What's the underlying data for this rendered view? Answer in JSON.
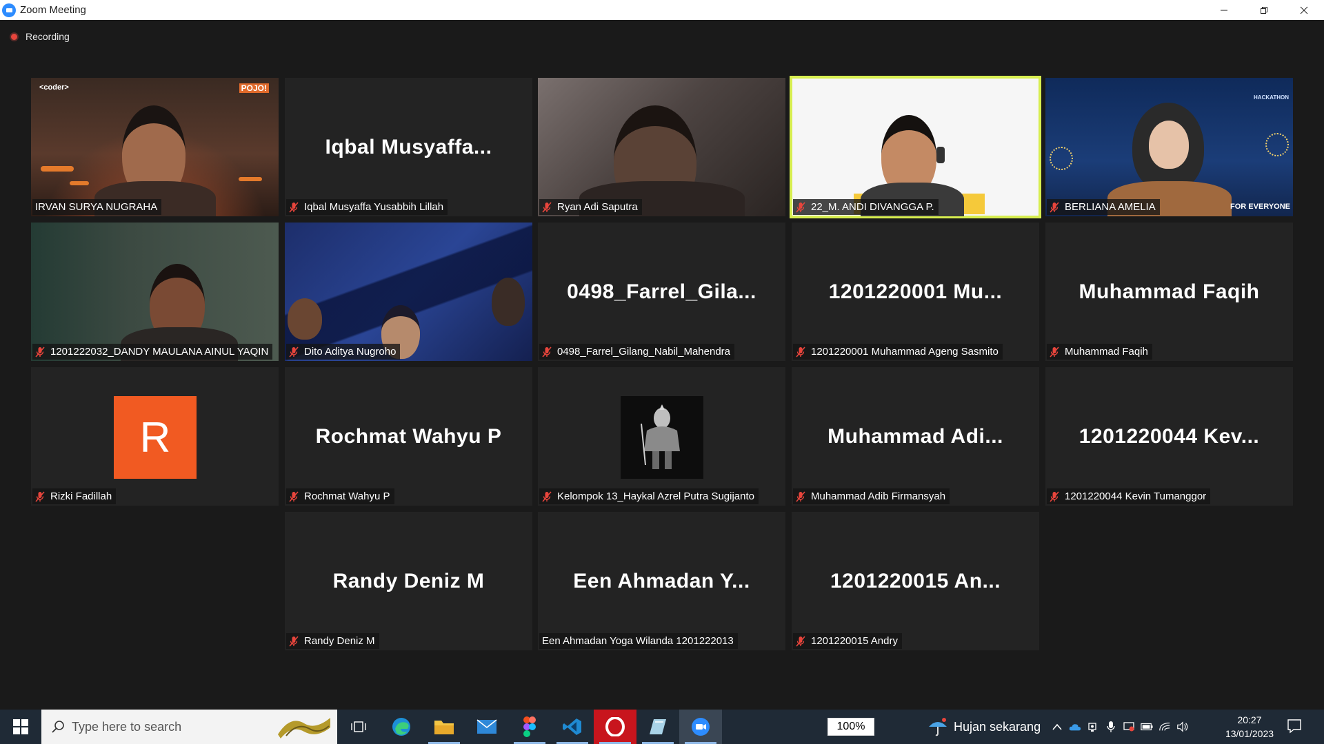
{
  "window": {
    "title": "Zoom Meeting"
  },
  "meeting": {
    "recording_label": "Recording"
  },
  "tiles": [
    {
      "label": "IRVAN SURYA NUGRAHA",
      "big": "",
      "muted": false
    },
    {
      "label": "Iqbal Musyaffa Yusabbih Lillah",
      "big": "Iqbal  Musyaffa...",
      "muted": true
    },
    {
      "label": "Ryan Adi Saputra",
      "big": "",
      "muted": true
    },
    {
      "label": "22_M. ANDI DIVANGGA P.",
      "big": "",
      "muted": true
    },
    {
      "label": "BERLIANA AMELIA",
      "big": "",
      "muted": true
    },
    {
      "label": "1201222032_DANDY MAULANA AINUL YAQIN",
      "big": "",
      "muted": true
    },
    {
      "label": "Dito Aditya Nugroho",
      "big": "",
      "muted": true
    },
    {
      "label": "0498_Farrel_Gilang_Nabil_Mahendra",
      "big": "0498_Farrel_Gila...",
      "muted": true
    },
    {
      "label": "1201220001 Muhammad Ageng Sasmito",
      "big": "1201220001  Mu...",
      "muted": true
    },
    {
      "label": "Muhammad Faqih",
      "big": "Muhammad Faqih",
      "muted": true
    },
    {
      "label": "Rizki Fadillah",
      "big": "",
      "avatar": "R",
      "muted": true
    },
    {
      "label": "Rochmat Wahyu P",
      "big": "Rochmat Wahyu P",
      "muted": true
    },
    {
      "label": "Kelompok 13_Haykal Azrel Putra Sugijanto",
      "big": "",
      "muted": true
    },
    {
      "label": "Muhammad Adib Firmansyah",
      "big": "Muhammad  Adi...",
      "muted": true
    },
    {
      "label": "1201220044 Kevin Tumanggor",
      "big": "1201220044  Kev...",
      "muted": true
    },
    {
      "label": "Randy Deniz M",
      "big": "Randy Deniz M",
      "muted": true
    },
    {
      "label": "Een Ahmadan Yoga Wilanda 1201222013",
      "big": "Een Ahmadan Y...",
      "muted": false
    },
    {
      "label": "1201220015 Andry",
      "big": "1201220015  An...",
      "muted": true
    }
  ],
  "video_overlays": {
    "irvan_left_logo": "<coder>",
    "irvan_right_logo": "POJO!",
    "berliana_banner": "FOR EVERYONE",
    "berliana_badge": "HACKATHON"
  },
  "taskbar": {
    "search_placeholder": "Type here to search",
    "zoom_level": "100%",
    "weather": "Hujan sekarang",
    "time": "20:27",
    "date": "13/01/2023"
  },
  "colors": {
    "active_speaker": "#d7ee4f",
    "mute_icon": "#e8453c",
    "tile_bg": "#232323"
  }
}
